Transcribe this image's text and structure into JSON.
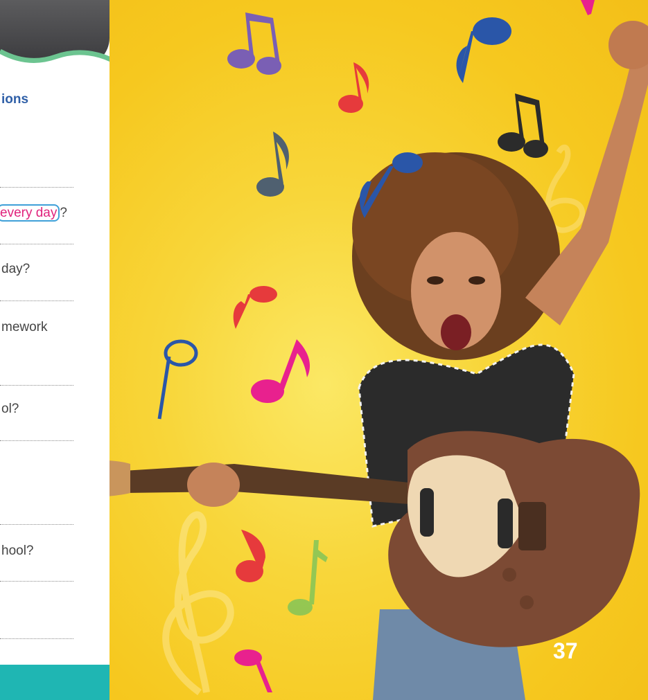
{
  "left_panel": {
    "title": "ions",
    "questions": [
      {
        "text_before": "",
        "highlight": "every day",
        "text_after": "?"
      },
      {
        "text_before": "day?",
        "highlight": "",
        "text_after": ""
      },
      {
        "text_before": "mework",
        "highlight": "",
        "text_after": ""
      },
      {
        "text_before": "ol?",
        "highlight": "",
        "text_after": ""
      },
      {
        "text_before": "hool?",
        "highlight": "",
        "text_after": ""
      }
    ]
  },
  "page_number": "37",
  "colors": {
    "background_yellow": "#f6c81f",
    "title_blue": "#2f5fa7",
    "highlight_pink": "#e0237c",
    "highlight_border": "#3fa0d8",
    "band_teal": "#1fb6b3"
  },
  "icons": [
    "music-note-icon",
    "treble-clef-icon",
    "guitar-illustration",
    "girl-photo"
  ]
}
